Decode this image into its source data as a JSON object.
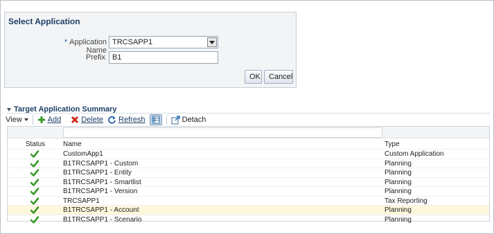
{
  "dialog": {
    "title": "Select Application",
    "app_label": "Application Name",
    "required_mark": "*",
    "app_value": "TRCSAPP1",
    "prefix_label": "Prefix",
    "prefix_value": "B1",
    "ok_label": "OK",
    "cancel_label": "Cancel"
  },
  "summary": {
    "title": "Target Application Summary",
    "toolbar": {
      "view_label": "View",
      "add_label": "Add",
      "delete_label": "Delete",
      "refresh_label": "Refresh",
      "detach_label": "Detach"
    },
    "columns": {
      "status": "Status",
      "name": "Name",
      "type": "Type"
    },
    "rows": [
      {
        "name": "CustomApp1",
        "type": "Custom Application"
      },
      {
        "name": "B1TRCSAPP1 - Custom",
        "type": "Planning"
      },
      {
        "name": "B1TRCSAPP1 - Entity",
        "type": "Planning"
      },
      {
        "name": "B1TRCSAPP1 - Smartlist",
        "type": "Planning"
      },
      {
        "name": "B1TRCSAPP1 - Version",
        "type": "Planning"
      },
      {
        "name": "TRCSAPP1",
        "type": "Tax Reporting"
      },
      {
        "name": "B1TRCSAPP1 - Account",
        "type": "Planning"
      },
      {
        "name": "B1TRCSAPP1 - Scenario",
        "type": "Planning"
      }
    ],
    "highlighted_row": 6
  },
  "colors": {
    "accent": "#1d3f66",
    "check": "#3a9a2a",
    "highlight": "#fdf8dc"
  },
  "icons": [
    "chevron-down-icon",
    "add-icon",
    "delete-icon",
    "refresh-icon",
    "freeze-icon",
    "detach-icon",
    "check-icon"
  ]
}
